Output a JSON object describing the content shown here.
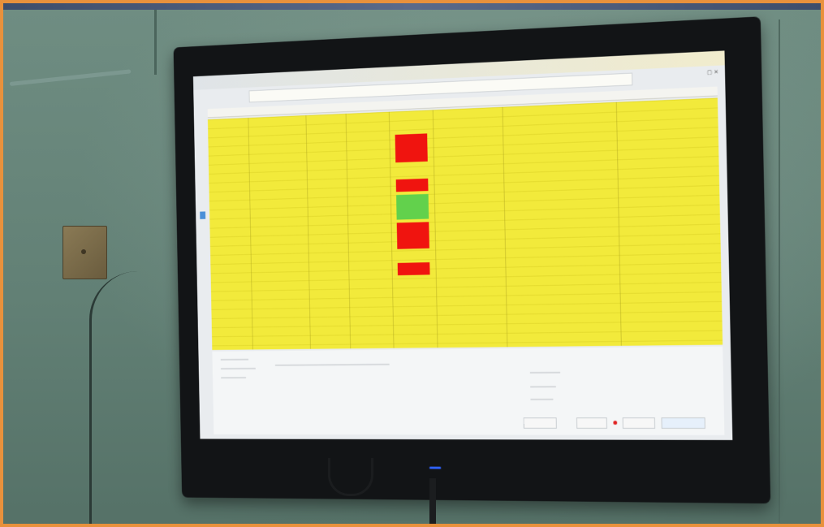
{
  "scene": {
    "description_kind": "photo-of-monitor",
    "frame_border_color": "#e8913c",
    "wall_color": "#628075"
  },
  "screen": {
    "grid_background": "#f2ea3b",
    "status_colors": {
      "alert": "#f0140f",
      "ok": "#62d14c"
    }
  }
}
